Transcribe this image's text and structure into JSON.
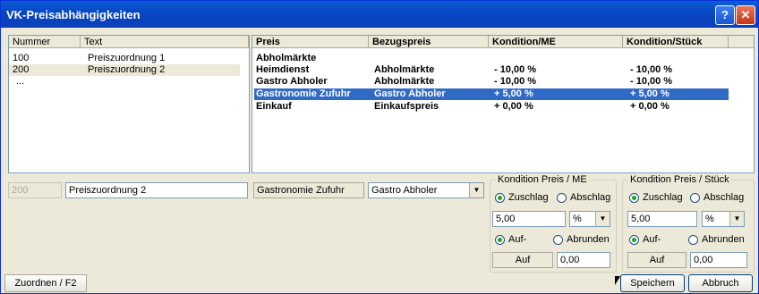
{
  "window": {
    "title": "VK-Preisabhängigkeiten",
    "help_glyph": "?",
    "close_glyph": "✕"
  },
  "left_list": {
    "headers": [
      "Nummer",
      "Text"
    ],
    "rows": [
      {
        "num": "100",
        "text": "Preiszuordnung 1"
      },
      {
        "num": "200",
        "text": "Preiszuordnung 2"
      },
      {
        "num": "...",
        "text": ""
      }
    ]
  },
  "right_list": {
    "headers": [
      "Preis",
      "Bezugspreis",
      "Kondition/ME",
      "Kondition/Stück"
    ],
    "rows": [
      {
        "preis": "Abholmärkte",
        "bezug": "",
        "kme": "",
        "kst": ""
      },
      {
        "preis": "Heimdienst",
        "bezug": "Abholmärkte",
        "kme": "- 10,00 %",
        "kst": "- 10,00 %"
      },
      {
        "preis": "Gastro Abholer",
        "bezug": "Abholmärkte",
        "kme": "- 10,00 %",
        "kst": "- 10,00 %"
      },
      {
        "preis": "Gastronomie Zufuhr",
        "bezug": "Gastro Abholer",
        "kme": "+ 5,00 %",
        "kst": "+ 5,00 %"
      },
      {
        "preis": "Einkauf",
        "bezug": "Einkaufspreis",
        "kme": "+ 0,00 %",
        "kst": "+ 0,00 %"
      }
    ]
  },
  "edit": {
    "number": "200",
    "text": "Preiszuordnung 2",
    "preis": "Gastronomie Zufuhr",
    "bezug": "Gastro Abholer"
  },
  "kond_me": {
    "title": "Kondition Preis / ME",
    "zuschlag": "Zuschlag",
    "abschlag": "Abschlag",
    "value": "5,00",
    "unit": "%",
    "auf": "Auf-",
    "ab": "Abrunden",
    "auf_label": "Auf",
    "auf_value": "0,00"
  },
  "kond_st": {
    "title": "Kondition Preis / Stück",
    "zuschlag": "Zuschlag",
    "abschlag": "Abschlag",
    "value": "5,00",
    "unit": "%",
    "auf": "Auf-",
    "ab": "Abrunden",
    "auf_label": "Auf",
    "auf_value": "0,00"
  },
  "buttons": {
    "zuordnen": "Zuordnen / F2",
    "speichern": "Speichern",
    "abbruch": "Abbruch"
  },
  "colors": {
    "title_bar": "#0a5fd6",
    "selection": "#316ac5"
  }
}
